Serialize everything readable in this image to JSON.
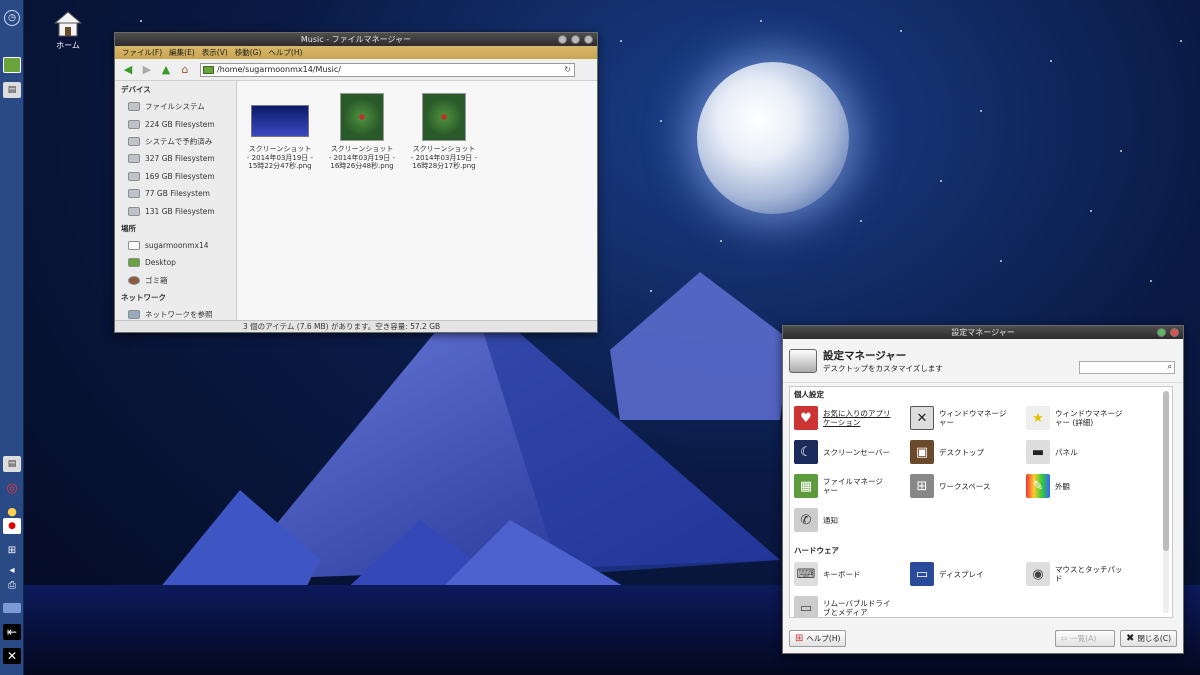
{
  "desktop": {
    "home_label": "ホーム"
  },
  "file_manager": {
    "title": "Music - ファイルマネージャー",
    "menu": [
      "ファイル(F)",
      "編集(E)",
      "表示(V)",
      "移動(G)",
      "ヘルプ(H)"
    ],
    "path": "/home/sugarmoonmx14/Music/",
    "sidebar": {
      "devices_header": "デバイス",
      "devices": [
        "ファイルシステム",
        "224 GB Filesystem",
        "システムで予約済み",
        "327 GB Filesystem",
        "169 GB Filesystem",
        "77 GB Filesystem",
        "131 GB Filesystem"
      ],
      "places_header": "場所",
      "places": [
        "sugarmoonmx14",
        "Desktop",
        "ゴミ箱"
      ],
      "network_header": "ネットワーク",
      "network": [
        "ネットワークを参照"
      ]
    },
    "files": [
      {
        "l1": "スクリーンショット",
        "l2": "- 2014年03月19日 -",
        "l3": "15時22分47秒.png"
      },
      {
        "l1": "スクリーンショット",
        "l2": "- 2014年03月19日 -",
        "l3": "16時26分48秒.png"
      },
      {
        "l1": "スクリーンショット",
        "l2": "- 2014年03月19日 -",
        "l3": "16時28分17秒.png"
      }
    ],
    "status": "3 個のアイテム (7.6 MB) があります。空き容量: 57.2 GB"
  },
  "settings_manager": {
    "title": "設定マネージャー",
    "heading": "設定マネージャー",
    "subtitle": "デスクトップをカスタマイズします",
    "section_personal": "個人設定",
    "section_hardware": "ハードウェア",
    "personal": [
      {
        "l1": "お気に入りのアプリ",
        "l2": "ケーション"
      },
      {
        "l1": "ウィンドウマネージ",
        "l2": "ャー"
      },
      {
        "l1": "ウィンドウマネージ",
        "l2": "ャー (詳細)"
      },
      {
        "l1": "スクリーンセーバー",
        "l2": ""
      },
      {
        "l1": "デスクトップ",
        "l2": ""
      },
      {
        "l1": "パネル",
        "l2": ""
      },
      {
        "l1": "ファイルマネージ",
        "l2": "ャー"
      },
      {
        "l1": "ワークスペース",
        "l2": ""
      },
      {
        "l1": "外観",
        "l2": ""
      },
      {
        "l1": "通知",
        "l2": ""
      }
    ],
    "hardware": [
      {
        "l1": "キーボード",
        "l2": ""
      },
      {
        "l1": "ディスプレイ",
        "l2": ""
      },
      {
        "l1": "マウスとタッチパッ",
        "l2": "ド"
      },
      {
        "l1": "リムーバブルドライ",
        "l2": "ブとメディア"
      }
    ],
    "help_button": "ヘルプ(H)",
    "all_button": "一覧(A)",
    "close_button": "閉じる(C)"
  }
}
